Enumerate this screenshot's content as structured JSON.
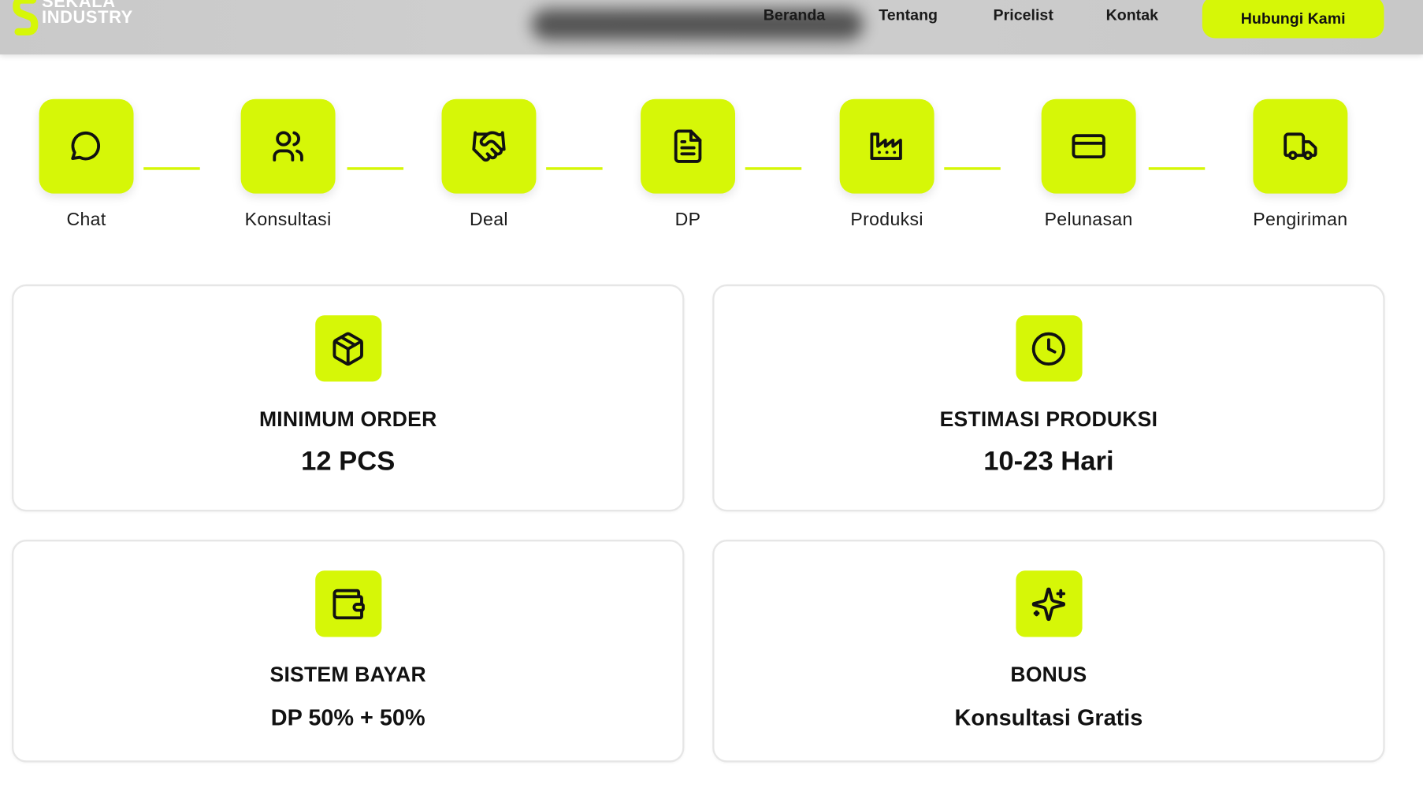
{
  "header": {
    "logo": {
      "line1": "SEKALA",
      "line2": "INDUSTRY"
    },
    "nav": [
      "Beranda",
      "Tentang",
      "Pricelist",
      "Kontak"
    ],
    "cta_label": "Hubungi Kami"
  },
  "steps": [
    {
      "label": "Chat",
      "icon": "chat-bubble-icon"
    },
    {
      "label": "Konsultasi",
      "icon": "users-icon"
    },
    {
      "label": "Deal",
      "icon": "handshake-icon"
    },
    {
      "label": "DP",
      "icon": "document-icon"
    },
    {
      "label": "Produksi",
      "icon": "factory-icon"
    },
    {
      "label": "Pelunasan",
      "icon": "credit-card-icon"
    },
    {
      "label": "Pengiriman",
      "icon": "truck-icon"
    }
  ],
  "cards": [
    {
      "title": "MINIMUM ORDER",
      "value": "12 PCS",
      "icon": "package-icon"
    },
    {
      "title": "ESTIMASI PRODUKSI",
      "value": "10-23 Hari",
      "icon": "clock-icon"
    },
    {
      "title": "SISTEM BAYAR",
      "value": "DP 50% + 50%",
      "icon": "wallet-icon"
    },
    {
      "title": "BONUS",
      "value": "Konsultasi Gratis",
      "icon": "sparkles-icon"
    }
  ],
  "colors": {
    "accent": "#d6f707",
    "header_bg": "#cbcbcb",
    "card_border": "#e6e6e6",
    "text": "#111111"
  }
}
